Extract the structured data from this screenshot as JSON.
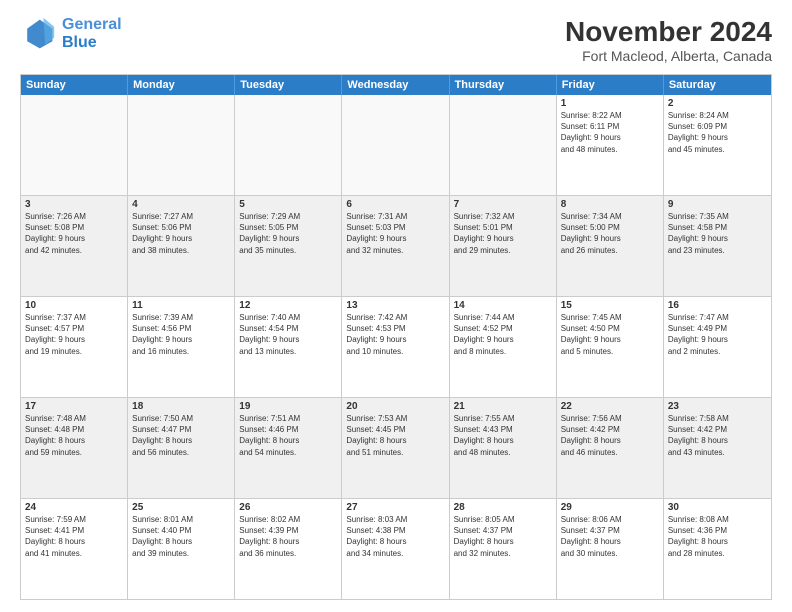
{
  "header": {
    "logo_line1": "General",
    "logo_line2": "Blue",
    "month": "November 2024",
    "location": "Fort Macleod, Alberta, Canada"
  },
  "weekdays": [
    "Sunday",
    "Monday",
    "Tuesday",
    "Wednesday",
    "Thursday",
    "Friday",
    "Saturday"
  ],
  "rows": [
    [
      {
        "day": "",
        "empty": true
      },
      {
        "day": "",
        "empty": true
      },
      {
        "day": "",
        "empty": true
      },
      {
        "day": "",
        "empty": true
      },
      {
        "day": "",
        "empty": true
      },
      {
        "day": "1",
        "info": "Sunrise: 8:22 AM\nSunset: 6:11 PM\nDaylight: 9 hours\nand 48 minutes."
      },
      {
        "day": "2",
        "info": "Sunrise: 8:24 AM\nSunset: 6:09 PM\nDaylight: 9 hours\nand 45 minutes."
      }
    ],
    [
      {
        "day": "3",
        "info": "Sunrise: 7:26 AM\nSunset: 5:08 PM\nDaylight: 9 hours\nand 42 minutes."
      },
      {
        "day": "4",
        "info": "Sunrise: 7:27 AM\nSunset: 5:06 PM\nDaylight: 9 hours\nand 38 minutes."
      },
      {
        "day": "5",
        "info": "Sunrise: 7:29 AM\nSunset: 5:05 PM\nDaylight: 9 hours\nand 35 minutes."
      },
      {
        "day": "6",
        "info": "Sunrise: 7:31 AM\nSunset: 5:03 PM\nDaylight: 9 hours\nand 32 minutes."
      },
      {
        "day": "7",
        "info": "Sunrise: 7:32 AM\nSunset: 5:01 PM\nDaylight: 9 hours\nand 29 minutes."
      },
      {
        "day": "8",
        "info": "Sunrise: 7:34 AM\nSunset: 5:00 PM\nDaylight: 9 hours\nand 26 minutes."
      },
      {
        "day": "9",
        "info": "Sunrise: 7:35 AM\nSunset: 4:58 PM\nDaylight: 9 hours\nand 23 minutes."
      }
    ],
    [
      {
        "day": "10",
        "info": "Sunrise: 7:37 AM\nSunset: 4:57 PM\nDaylight: 9 hours\nand 19 minutes."
      },
      {
        "day": "11",
        "info": "Sunrise: 7:39 AM\nSunset: 4:56 PM\nDaylight: 9 hours\nand 16 minutes."
      },
      {
        "day": "12",
        "info": "Sunrise: 7:40 AM\nSunset: 4:54 PM\nDaylight: 9 hours\nand 13 minutes."
      },
      {
        "day": "13",
        "info": "Sunrise: 7:42 AM\nSunset: 4:53 PM\nDaylight: 9 hours\nand 10 minutes."
      },
      {
        "day": "14",
        "info": "Sunrise: 7:44 AM\nSunset: 4:52 PM\nDaylight: 9 hours\nand 8 minutes."
      },
      {
        "day": "15",
        "info": "Sunrise: 7:45 AM\nSunset: 4:50 PM\nDaylight: 9 hours\nand 5 minutes."
      },
      {
        "day": "16",
        "info": "Sunrise: 7:47 AM\nSunset: 4:49 PM\nDaylight: 9 hours\nand 2 minutes."
      }
    ],
    [
      {
        "day": "17",
        "info": "Sunrise: 7:48 AM\nSunset: 4:48 PM\nDaylight: 8 hours\nand 59 minutes."
      },
      {
        "day": "18",
        "info": "Sunrise: 7:50 AM\nSunset: 4:47 PM\nDaylight: 8 hours\nand 56 minutes."
      },
      {
        "day": "19",
        "info": "Sunrise: 7:51 AM\nSunset: 4:46 PM\nDaylight: 8 hours\nand 54 minutes."
      },
      {
        "day": "20",
        "info": "Sunrise: 7:53 AM\nSunset: 4:45 PM\nDaylight: 8 hours\nand 51 minutes."
      },
      {
        "day": "21",
        "info": "Sunrise: 7:55 AM\nSunset: 4:43 PM\nDaylight: 8 hours\nand 48 minutes."
      },
      {
        "day": "22",
        "info": "Sunrise: 7:56 AM\nSunset: 4:42 PM\nDaylight: 8 hours\nand 46 minutes."
      },
      {
        "day": "23",
        "info": "Sunrise: 7:58 AM\nSunset: 4:42 PM\nDaylight: 8 hours\nand 43 minutes."
      }
    ],
    [
      {
        "day": "24",
        "info": "Sunrise: 7:59 AM\nSunset: 4:41 PM\nDaylight: 8 hours\nand 41 minutes."
      },
      {
        "day": "25",
        "info": "Sunrise: 8:01 AM\nSunset: 4:40 PM\nDaylight: 8 hours\nand 39 minutes."
      },
      {
        "day": "26",
        "info": "Sunrise: 8:02 AM\nSunset: 4:39 PM\nDaylight: 8 hours\nand 36 minutes."
      },
      {
        "day": "27",
        "info": "Sunrise: 8:03 AM\nSunset: 4:38 PM\nDaylight: 8 hours\nand 34 minutes."
      },
      {
        "day": "28",
        "info": "Sunrise: 8:05 AM\nSunset: 4:37 PM\nDaylight: 8 hours\nand 32 minutes."
      },
      {
        "day": "29",
        "info": "Sunrise: 8:06 AM\nSunset: 4:37 PM\nDaylight: 8 hours\nand 30 minutes."
      },
      {
        "day": "30",
        "info": "Sunrise: 8:08 AM\nSunset: 4:36 PM\nDaylight: 8 hours\nand 28 minutes."
      }
    ]
  ]
}
